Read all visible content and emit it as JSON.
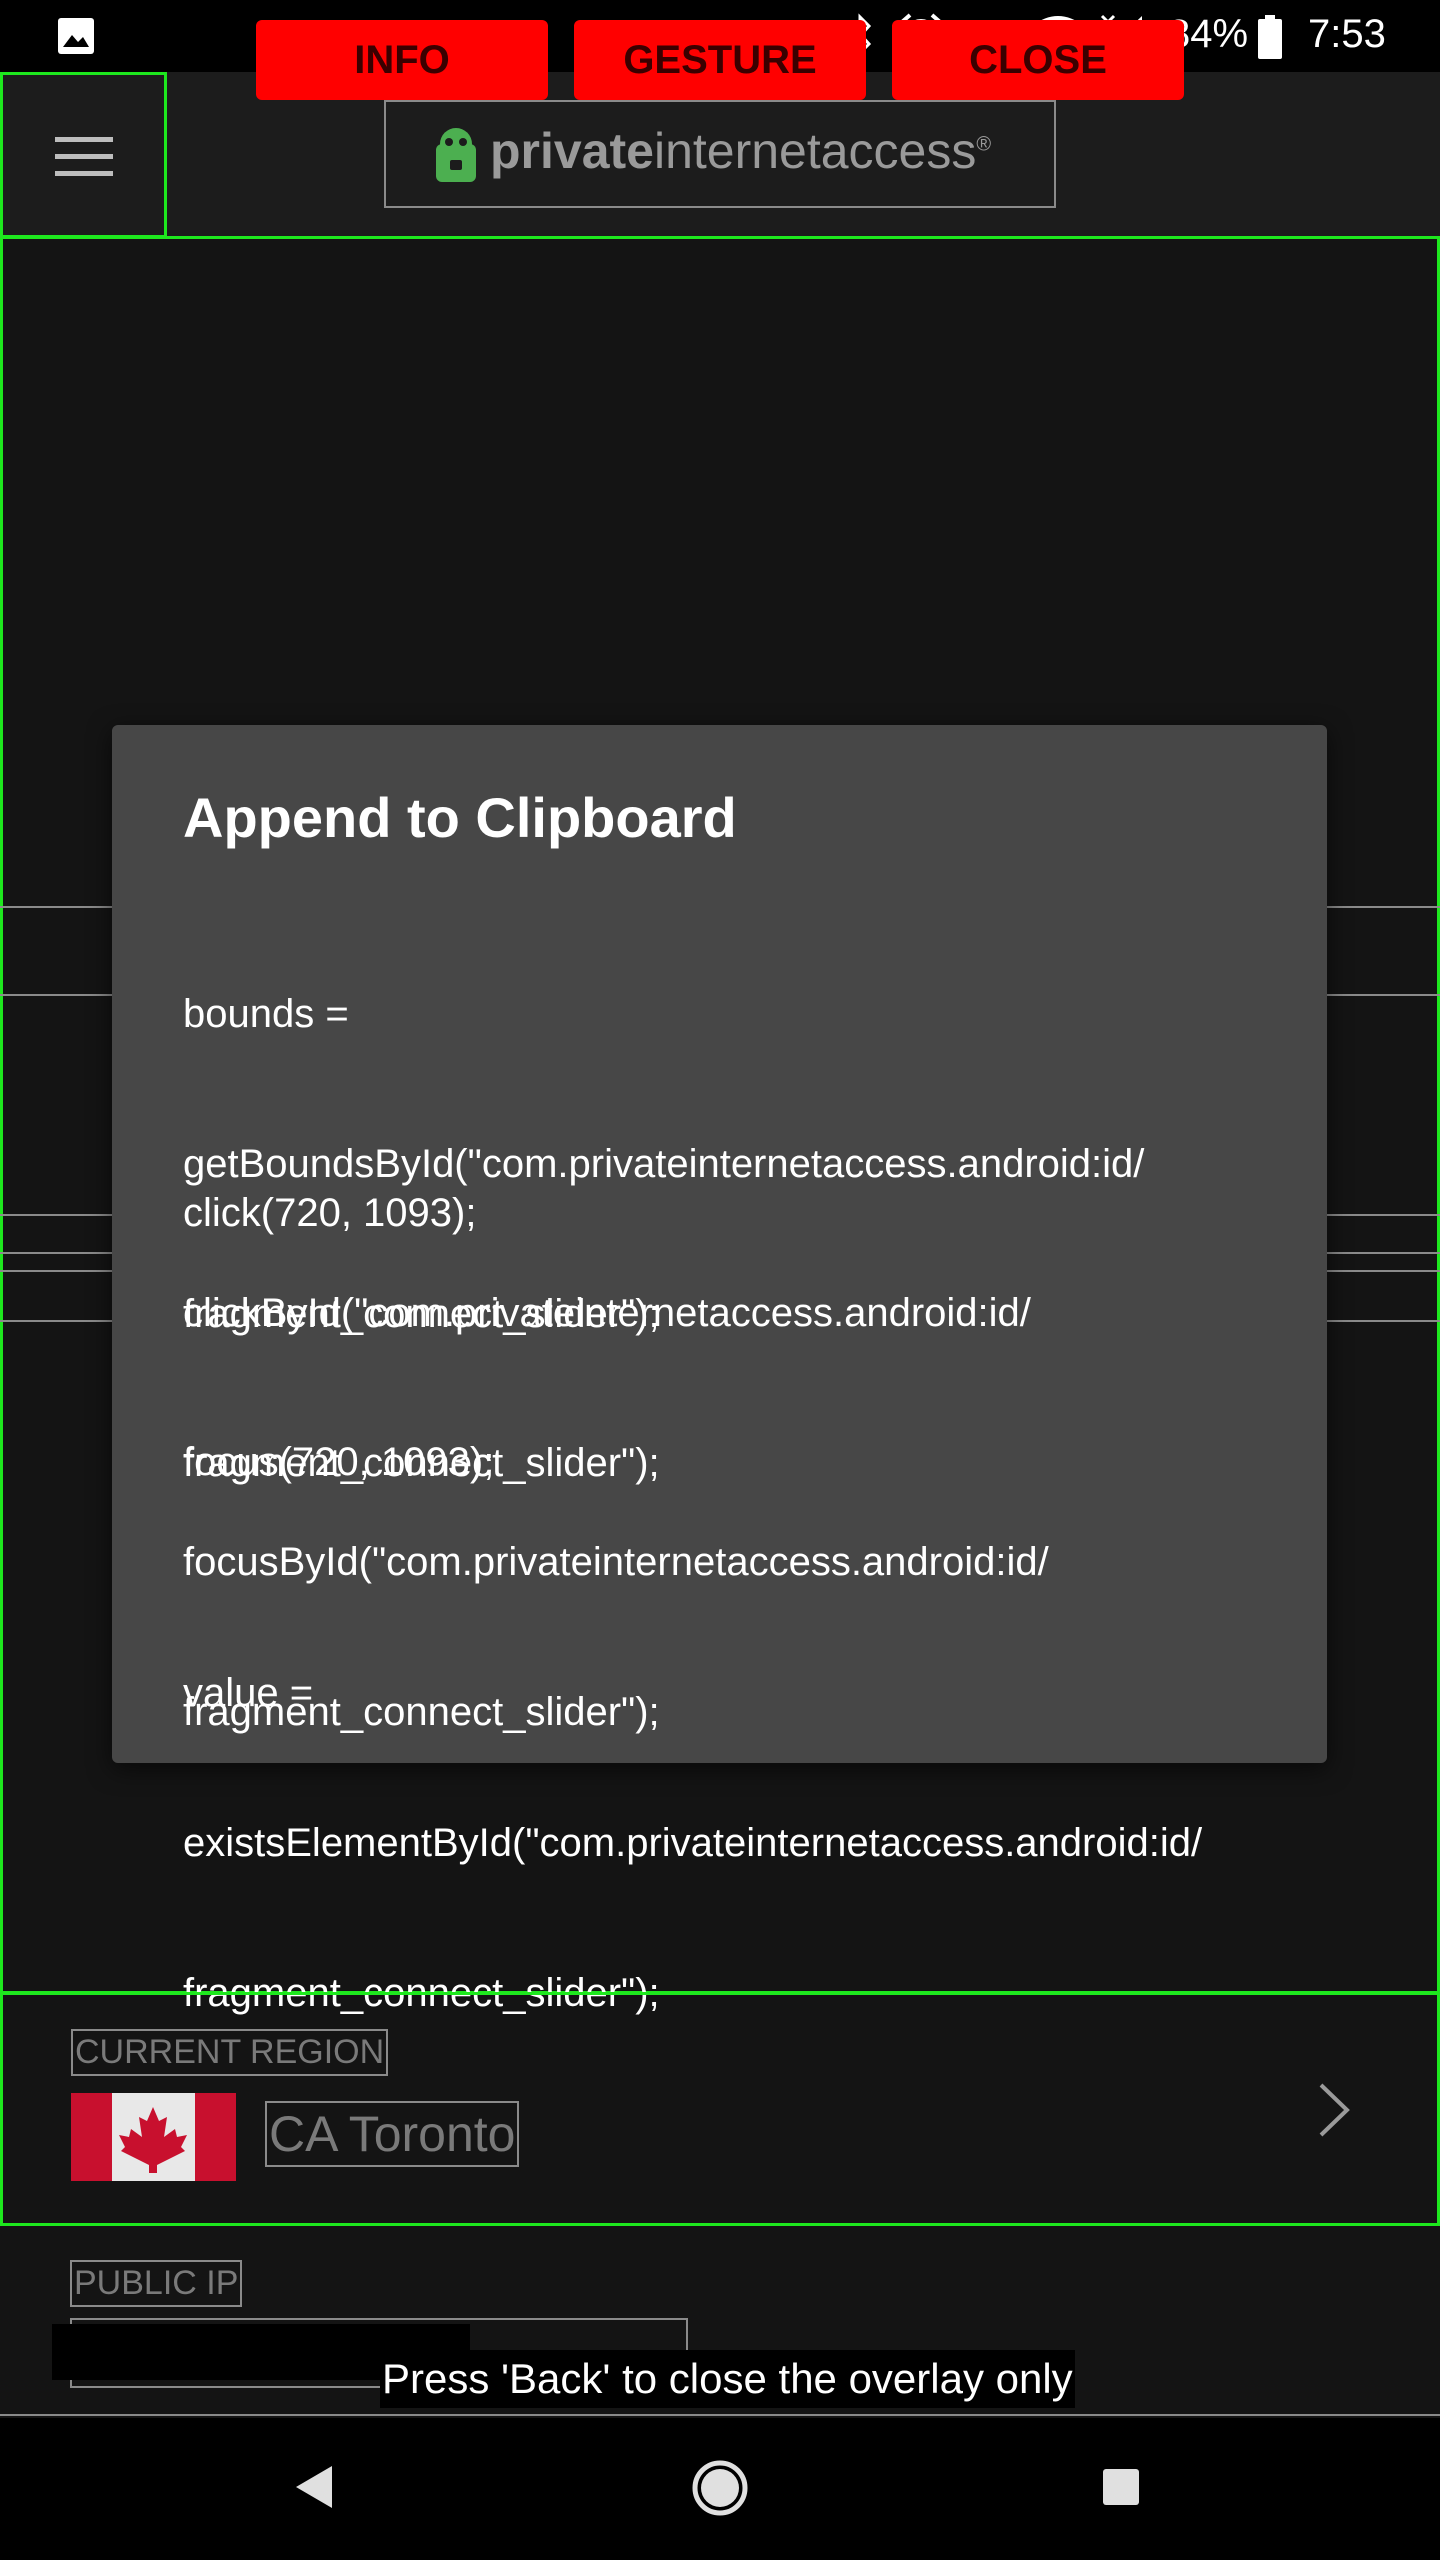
{
  "status_bar": {
    "battery": "84%",
    "time": "7:53",
    "icons": [
      "image-icon",
      "bluetooth-icon",
      "alarm-icon",
      "vpn-key-icon",
      "wifi-icon",
      "signal-icon",
      "battery-icon"
    ]
  },
  "overlay_buttons": {
    "info": "INFO",
    "gesture": "GESTURE",
    "close": "CLOSE"
  },
  "toolbar": {
    "logo_bold": "private",
    "logo_light": "internetaccess",
    "logo_mark": "®"
  },
  "dialog": {
    "title": "Append to Clipboard",
    "lines": [
      "bounds =",
      "getBoundsById(\"com.privateinternetaccess.android:id/",
      "fragment_connect_slider\");",
      "click(720, 1093);",
      "clickById(\"com.privateinternetaccess.android:id/",
      "fragment_connect_slider\");",
      "focus(720, 1093);",
      "focusById(\"com.privateinternetaccess.android:id/",
      "fragment_connect_slider\");",
      "value =",
      "existsElementById(\"com.privateinternetaccess.android:id/",
      "fragment_connect_slider\");"
    ]
  },
  "region": {
    "label": "CURRENT REGION",
    "value": "CA Toronto"
  },
  "public_ip": {
    "label": "PUBLIC IP"
  },
  "toast": "Press 'Back' to close the overlay only",
  "colors": {
    "highlight": "#1ee81e",
    "overlay_button": "#ff0000",
    "dialog_bg": "#474747"
  }
}
